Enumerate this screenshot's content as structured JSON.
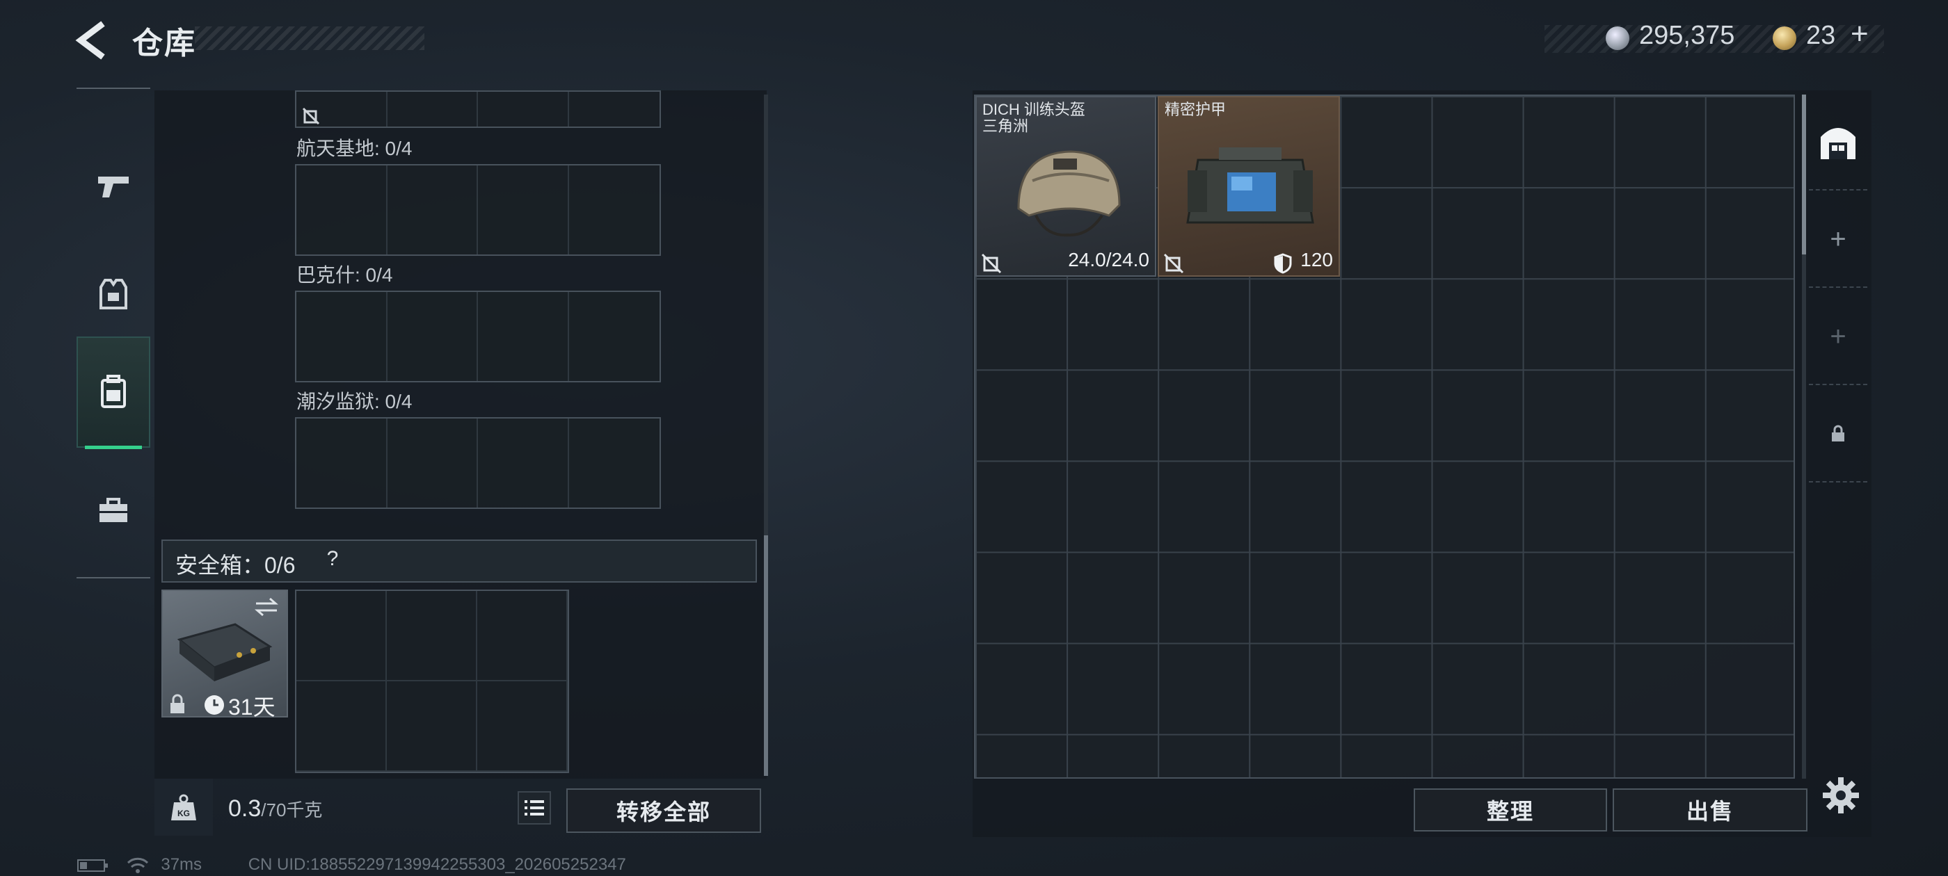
{
  "header": {
    "title": "仓库",
    "currency_silver": "295,375",
    "currency_gold": "23",
    "currency_plus": "+"
  },
  "tabs": [
    {
      "icon": "pistol-icon"
    },
    {
      "icon": "armor-vest-icon"
    },
    {
      "icon": "backpack-icon",
      "active": true
    },
    {
      "icon": "toolbox-icon"
    }
  ],
  "left": {
    "maps": [
      {
        "label": "航天基地: 0/4"
      },
      {
        "label": "巴克什: 0/4"
      },
      {
        "label": "潮汐监狱: 0/4"
      }
    ],
    "safe_box_label": "安全箱：0/6",
    "safe_box_help": "?",
    "case_duration": "31天",
    "weight_current": "0.3",
    "weight_max": "/70千克",
    "weight_unit_icon": "KG",
    "transfer_all": "转移全部"
  },
  "storage": {
    "items": [
      {
        "name_line1": "DICH 训练头盔",
        "name_line2": "三角洲",
        "value": "24.0/24.0"
      },
      {
        "name_line1": "精密护甲",
        "name_line2": "",
        "value": "120"
      }
    ],
    "sort_label": "整理",
    "sell_label": "出售"
  },
  "status": {
    "ping": "37ms",
    "uid": "CN UID:188552297139942255303_202605252347"
  }
}
